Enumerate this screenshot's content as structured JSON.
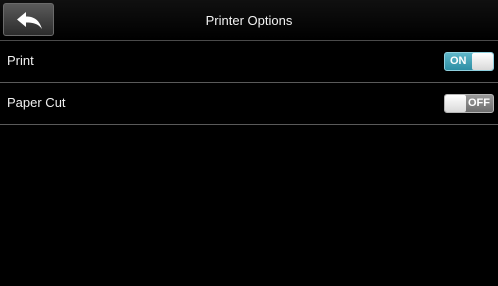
{
  "header": {
    "title": "Printer Options",
    "back_icon": "back-arrow-icon"
  },
  "settings": [
    {
      "label": "Print",
      "state": "ON",
      "enabled": true,
      "accent": "#3a9cb2"
    },
    {
      "label": "Paper Cut",
      "state": "OFF",
      "enabled": false,
      "accent": "#8a8a8a"
    }
  ]
}
